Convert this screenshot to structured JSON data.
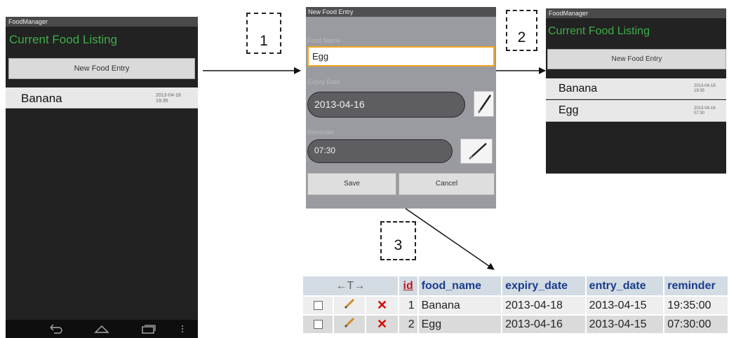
{
  "phone1": {
    "app_title": "FoodManager",
    "heading": "Current Food Listing",
    "new_entry_label": "New Food Entry",
    "items": [
      {
        "name": "Banana",
        "date": "2013-04-18",
        "time": "19:35"
      }
    ],
    "nav_icons": [
      "back-icon",
      "home-icon",
      "recent-apps-icon",
      "menu-dots-icon"
    ]
  },
  "dialog": {
    "title": "New Food Entry",
    "food_name_label": "Food Name",
    "food_name_value": "Egg",
    "expiry_label": "Expiry Date",
    "expiry_value": "2013-04-16",
    "reminder_label": "Reminder",
    "reminder_value": "07:30",
    "save_label": "Save",
    "cancel_label": "Cancel"
  },
  "phone2": {
    "app_title": "FoodManager",
    "heading": "Current Food Listing",
    "new_entry_label": "New Food Entry",
    "items": [
      {
        "name": "Banana",
        "date": "2013-04-18",
        "time": "19:35"
      },
      {
        "name": "Egg",
        "date": "2013-04-16",
        "time": "07:30"
      }
    ]
  },
  "steps": [
    "1",
    "2",
    "3"
  ],
  "db_table": {
    "sort_arrows": "←T→",
    "columns": [
      "id",
      "food_name",
      "expiry_date",
      "entry_date",
      "reminder"
    ],
    "rows": [
      {
        "id": "1",
        "food_name": "Banana",
        "expiry_date": "2013-04-18",
        "entry_date": "2013-04-15",
        "reminder": "19:35:00"
      },
      {
        "id": "2",
        "food_name": "Egg",
        "expiry_date": "2013-04-16",
        "entry_date": "2013-04-15",
        "reminder": "07:30:00"
      }
    ]
  },
  "colors": {
    "heading_green": "#3fae49",
    "focus_orange": "#f5a623",
    "table_header_blue": "#1a3c8c",
    "delete_red": "#dd0000"
  }
}
